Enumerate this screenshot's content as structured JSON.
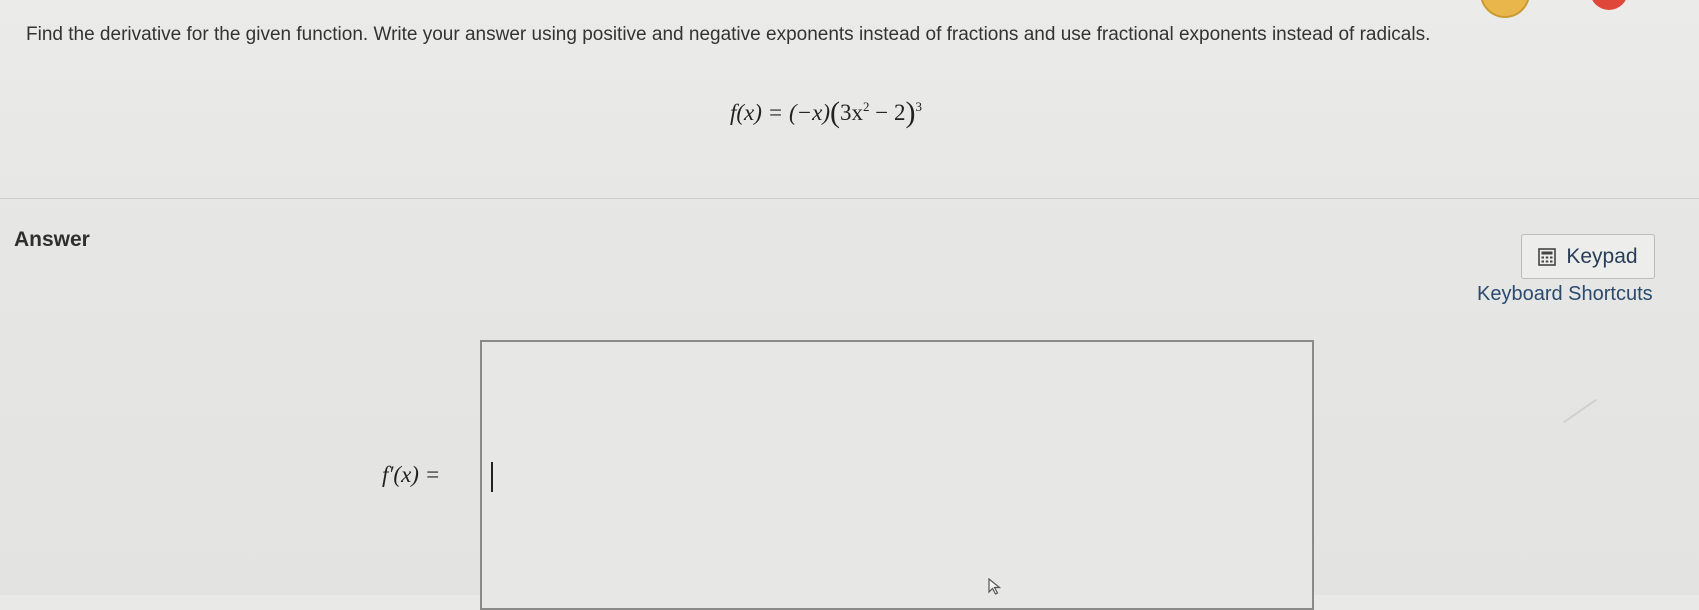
{
  "question": {
    "prompt": "Find the derivative for the given function. Write your answer using positive and negative exponents instead of fractions and use fractional exponents instead of radicals.",
    "function_lhs": "f(x) = (−x)",
    "function_inner": "3x",
    "inner_exponent": "2",
    "inner_rest": " − 2",
    "outer_exponent": "3"
  },
  "answer": {
    "heading": "Answer",
    "derivative_label": "f′(x) =",
    "input_value": ""
  },
  "tools": {
    "keypad_label": "Keypad",
    "shortcuts_label": "Keyboard Shortcuts"
  },
  "icons": {
    "keypad": "calculator-icon",
    "pointer": "mouse-pointer-icon"
  },
  "colors": {
    "link": "#2a4a70",
    "badge_yellow": "#e8b64a",
    "badge_red": "#e0473b"
  }
}
